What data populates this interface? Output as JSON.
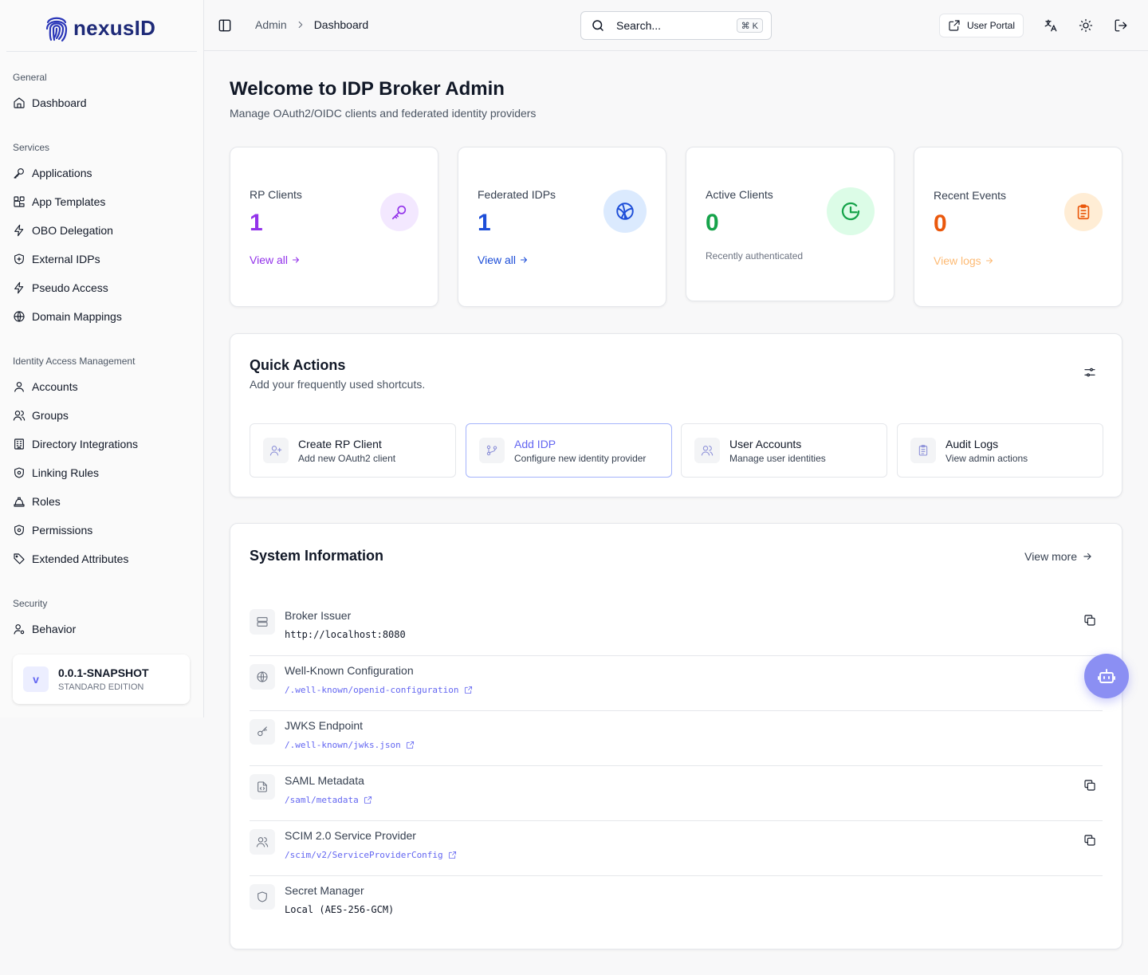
{
  "brand": {
    "name": "nexusID"
  },
  "sidebar": {
    "groups": [
      {
        "label": "General",
        "items": [
          {
            "label": "Dashboard",
            "icon": "home-icon"
          }
        ]
      },
      {
        "label": "Services",
        "items": [
          {
            "label": "Applications",
            "icon": "key-icon"
          },
          {
            "label": "App Templates",
            "icon": "blocks-icon"
          },
          {
            "label": "OBO Delegation",
            "icon": "zap-icon"
          },
          {
            "label": "External IDPs",
            "icon": "shield-plus-icon"
          },
          {
            "label": "Pseudo Access",
            "icon": "zap-icon"
          },
          {
            "label": "Domain Mappings",
            "icon": "globe-icon"
          }
        ]
      },
      {
        "label": "Identity Access Management",
        "items": [
          {
            "label": "Accounts",
            "icon": "user-icon"
          },
          {
            "label": "Groups",
            "icon": "users-icon"
          },
          {
            "label": "Directory Integrations",
            "icon": "building-icon"
          },
          {
            "label": "Linking Rules",
            "icon": "shield-cog-icon"
          },
          {
            "label": "Roles",
            "icon": "hat-icon"
          },
          {
            "label": "Permissions",
            "icon": "shield-cog-icon"
          },
          {
            "label": "Extended Attributes",
            "icon": "tag-icon"
          }
        ]
      },
      {
        "label": "Security",
        "items": [
          {
            "label": "Behavior",
            "icon": "user-cog-icon"
          }
        ]
      }
    ],
    "version": {
      "badge": "v",
      "title": "0.0.1-SNAPSHOT",
      "edition": "STANDARD EDITION"
    }
  },
  "topbar": {
    "breadcrumb": [
      "Admin",
      "Dashboard"
    ],
    "search": {
      "placeholder": "Search...",
      "shortcut": "⌘ K"
    },
    "portal_label": "User Portal"
  },
  "header": {
    "title": "Welcome to IDP Broker Admin",
    "subtitle": "Manage OAuth2/OIDC clients and federated identity providers"
  },
  "stats": [
    {
      "label": "RP Clients",
      "value": "1",
      "link": "View all",
      "color": "#9333ea",
      "icon": "key-icon"
    },
    {
      "label": "Federated IDPs",
      "value": "1",
      "link": "View all",
      "color": "#1d4ed8",
      "icon": "globe-icon"
    },
    {
      "label": "Active Clients",
      "value": "0",
      "note": "Recently authenticated",
      "color": "#16a34a",
      "icon": "clock-icon"
    },
    {
      "label": "Recent Events",
      "value": "0",
      "link": "View logs",
      "color": "#ea580c",
      "icon": "clipboard-icon"
    }
  ],
  "quick_actions": {
    "title": "Quick Actions",
    "subtitle": "Add your frequently used shortcuts.",
    "items": [
      {
        "title": "Create RP Client",
        "desc": "Add new OAuth2 client",
        "icon": "user-plus-icon"
      },
      {
        "title": "Add IDP",
        "desc": "Configure new identity provider",
        "icon": "git-branch-icon"
      },
      {
        "title": "User Accounts",
        "desc": "Manage user identities",
        "icon": "users-icon"
      },
      {
        "title": "Audit Logs",
        "desc": "View admin actions",
        "icon": "clipboard-icon"
      }
    ]
  },
  "system_info": {
    "title": "System Information",
    "view_more": "View more",
    "rows": [
      {
        "label": "Broker Issuer",
        "value": "http://localhost:8080",
        "icon": "server-icon"
      },
      {
        "label": "Well-Known Configuration",
        "link": "/.well-known/openid-configuration",
        "icon": "globe-icon"
      },
      {
        "label": "JWKS Endpoint",
        "link": "/.well-known/jwks.json",
        "icon": "key-icon"
      },
      {
        "label": "SAML Metadata",
        "link": "/saml/metadata",
        "icon": "file-code-icon"
      },
      {
        "label": "SCIM 2.0 Service Provider",
        "link": "/scim/v2/ServiceProviderConfig",
        "icon": "users-icon"
      },
      {
        "label": "Secret Manager",
        "value": "Local (AES-256-GCM)",
        "icon": "shield-icon"
      }
    ]
  },
  "colors": {
    "accent": "#6366f1",
    "fab": "#8b8ff3"
  }
}
